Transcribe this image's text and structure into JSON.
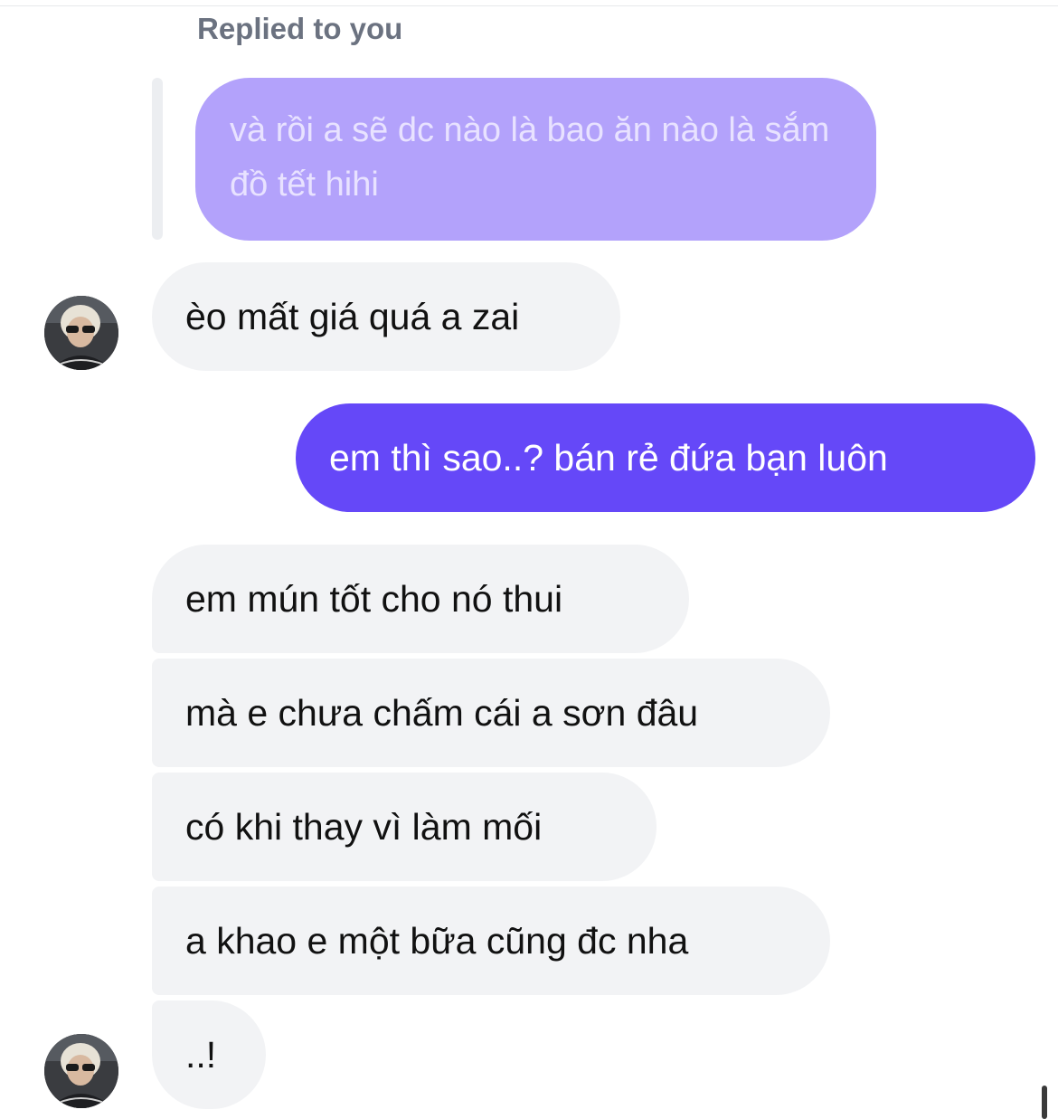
{
  "conversation": {
    "reply_header": "Replied to you",
    "quoted_message": "và rồi a sẽ dc nào là bao ăn nào là sắm đồ tết hihi",
    "messages": [
      {
        "direction": "incoming",
        "text": "èo mất giá quá a zai"
      },
      {
        "direction": "outgoing",
        "text": "em thì sao..? bán rẻ đứa bạn luôn"
      },
      {
        "direction": "incoming",
        "text": "em mún tốt cho nó thui"
      },
      {
        "direction": "incoming",
        "text": "mà e chưa chấm cái a sơn đâu"
      },
      {
        "direction": "incoming",
        "text": "có khi thay vì làm mối"
      },
      {
        "direction": "incoming",
        "text": "a khao e một bữa cũng đc nha"
      },
      {
        "direction": "incoming",
        "text": "..!"
      }
    ]
  },
  "icons": {
    "avatar": "contact-avatar-icon"
  },
  "colors": {
    "outgoing_bubble": "#6548f8",
    "quoted_bubble": "#b3a2fb",
    "incoming_bubble": "#f2f3f5",
    "meta_text": "#6b7280"
  }
}
